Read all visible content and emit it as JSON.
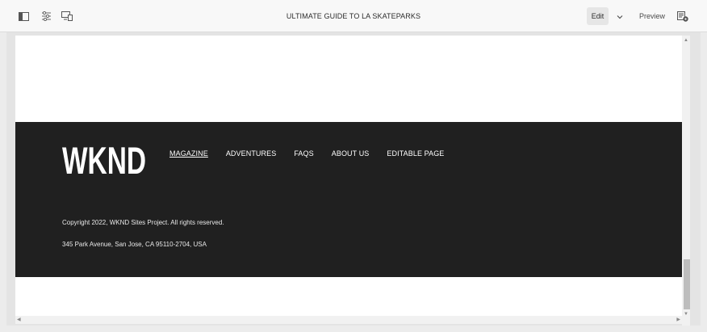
{
  "toolbar": {
    "icons": [
      "side-panel-icon",
      "page-properties-icon",
      "emulator-icon"
    ],
    "title": "ULTIMATE GUIDE TO LA SKATEPARKS",
    "mode_label": "Edit",
    "preview_label": "Preview",
    "page_info_icon": "page-info-icon"
  },
  "footer": {
    "logo_text": "WKND",
    "nav": [
      {
        "label": "MAGAZINE",
        "active": true
      },
      {
        "label": "ADVENTURES",
        "active": false
      },
      {
        "label": "FAQS",
        "active": false
      },
      {
        "label": "ABOUT US",
        "active": false
      },
      {
        "label": "EDITABLE PAGE",
        "active": false
      }
    ],
    "copyright": "Copyright 2022, WKND Sites Project. All rights reserved.",
    "address": "345 Park Avenue, San Jose, CA 95110-2704, USA"
  },
  "colors": {
    "footer_bg": "#202020",
    "toolbar_bg": "#f8f8f8",
    "canvas_bg": "#e4e4e4"
  }
}
